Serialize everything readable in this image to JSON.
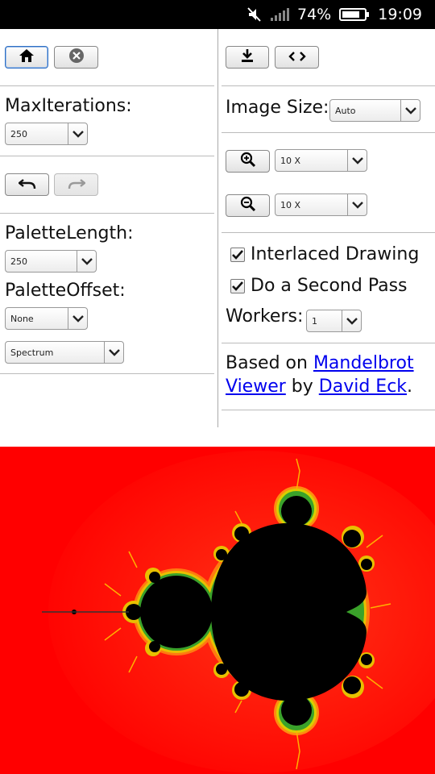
{
  "status_bar": {
    "battery_percent": "74%",
    "time": "19:09",
    "icons": [
      "mute-icon",
      "signal-icon",
      "battery-icon"
    ]
  },
  "left_panel": {
    "home_button": "home-icon",
    "stop_button": "close-circle-icon",
    "max_iterations_label": "MaxIterations:",
    "max_iterations_value": "250",
    "undo_button": "undo-icon",
    "redo_button": "redo-icon",
    "palette_length_label": "PaletteLength:",
    "palette_length_value": "250",
    "palette_offset_label": "PaletteOffset:",
    "palette_offset_value": "None",
    "palette_value": "Spectrum"
  },
  "right_panel": {
    "download_button": "download-icon",
    "code_button": "code-icon",
    "image_size_label": "Image Size:",
    "image_size_value": "Auto",
    "zoom_in_button": "zoom-in-icon",
    "zoom_in_value": "10 X",
    "zoom_out_button": "zoom-out-icon",
    "zoom_out_value": "10 X",
    "interlaced_label": "Interlaced Drawing",
    "interlaced_checked": true,
    "second_pass_label": "Do a Second Pass",
    "second_pass_checked": true,
    "workers_label": "Workers:",
    "workers_value": "1",
    "credit_prefix": "Based on ",
    "credit_link1": "Mandelbrot Viewer",
    "credit_middle": " by ",
    "credit_link2": "David Eck",
    "credit_suffix": "."
  },
  "fractal": {
    "background_color": "#ff0000",
    "set_color": "#000000"
  }
}
